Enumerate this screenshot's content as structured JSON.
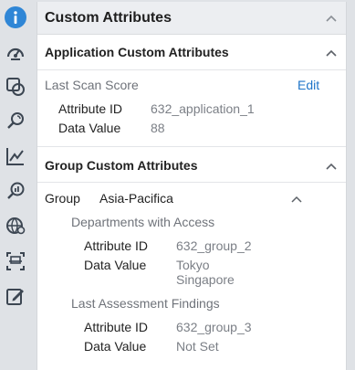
{
  "rail": {
    "icons": [
      {
        "name": "info-icon"
      },
      {
        "name": "dashboard-gauge-icon"
      },
      {
        "name": "shapes-icon"
      },
      {
        "name": "scan-search-icon"
      },
      {
        "name": "trend-chart-icon"
      },
      {
        "name": "search-report-icon"
      },
      {
        "name": "globe-settings-icon"
      },
      {
        "name": "screen-scan-icon"
      },
      {
        "name": "edit-note-icon"
      }
    ]
  },
  "panel": {
    "title": "Custom Attributes",
    "app_section": {
      "title": "Application Custom Attributes",
      "group_label": "Last Scan Score",
      "edit_label": "Edit",
      "rows": [
        {
          "label": "Attribute ID",
          "value": "632_application_1"
        },
        {
          "label": "Data Value",
          "value": "88"
        }
      ]
    },
    "group_section": {
      "title": "Group Custom Attributes",
      "group_key": "Group",
      "group_value": "Asia-Pacifica",
      "subgroups": [
        {
          "title": "Departments with Access",
          "rows": [
            {
              "label": "Attribute ID",
              "value": "632_group_2"
            },
            {
              "label": "Data Value",
              "value": "Tokyo",
              "value2": "Singapore"
            }
          ]
        },
        {
          "title": "Last Assessment Findings",
          "rows": [
            {
              "label": "Attribute ID",
              "value": "632_group_3"
            },
            {
              "label": "Data Value",
              "value": "Not Set"
            }
          ]
        }
      ]
    }
  }
}
